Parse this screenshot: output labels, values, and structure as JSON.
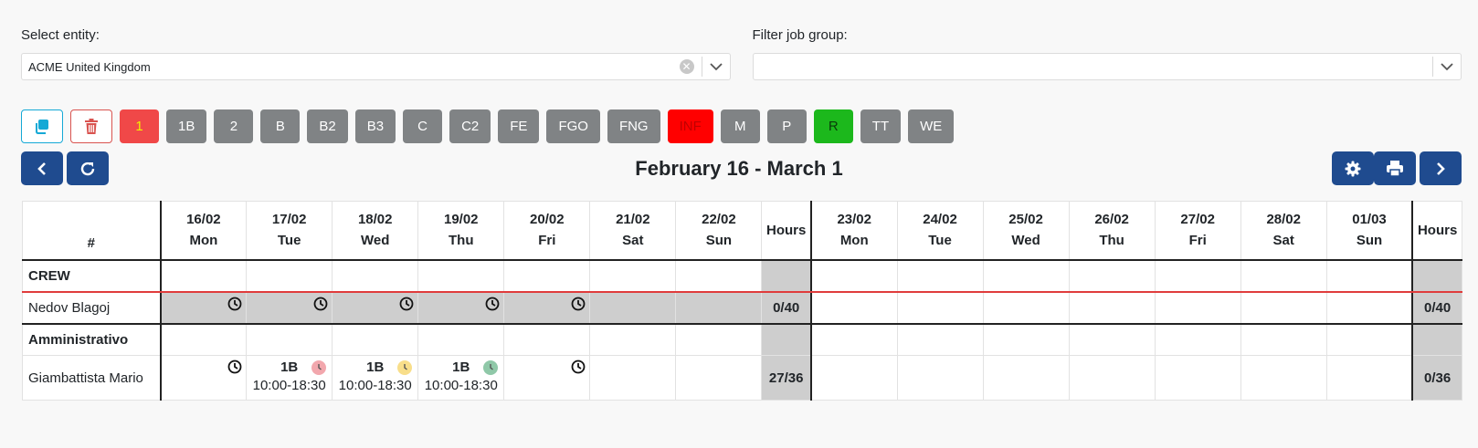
{
  "filters": {
    "entity_label": "Select entity:",
    "entity_value": "ACME United Kingdom",
    "job_group_label": "Filter job group:",
    "job_group_value": ""
  },
  "toolbar": {
    "tags": [
      {
        "label": "1",
        "bg": "#f04848",
        "fg": "#f0f000"
      },
      {
        "label": "1B",
        "bg": "#808385",
        "fg": "#ffffff"
      },
      {
        "label": "2",
        "bg": "#808385",
        "fg": "#ffffff"
      },
      {
        "label": "B",
        "bg": "#808385",
        "fg": "#ffffff"
      },
      {
        "label": "B2",
        "bg": "#808385",
        "fg": "#ffffff"
      },
      {
        "label": "B3",
        "bg": "#808385",
        "fg": "#ffffff"
      },
      {
        "label": "C",
        "bg": "#808385",
        "fg": "#ffffff"
      },
      {
        "label": "C2",
        "bg": "#808385",
        "fg": "#ffffff"
      },
      {
        "label": "FE",
        "bg": "#808385",
        "fg": "#ffffff"
      },
      {
        "label": "FGO",
        "bg": "#808385",
        "fg": "#ffffff"
      },
      {
        "label": "FNG",
        "bg": "#808385",
        "fg": "#ffffff"
      },
      {
        "label": "INF",
        "bg": "#ff0000",
        "fg": "#c00000"
      },
      {
        "label": "M",
        "bg": "#808385",
        "fg": "#ffffff"
      },
      {
        "label": "P",
        "bg": "#808385",
        "fg": "#ffffff"
      },
      {
        "label": "R",
        "bg": "#1cb81c",
        "fg": "#0a3a0a"
      },
      {
        "label": "TT",
        "bg": "#808385",
        "fg": "#ffffff"
      },
      {
        "label": "WE",
        "bg": "#808385",
        "fg": "#ffffff"
      }
    ]
  },
  "period": {
    "title": "February 16 - March 1"
  },
  "table": {
    "hash_header": "#",
    "hours_header": "Hours",
    "week1": [
      {
        "date": "16/02",
        "day": "Mon"
      },
      {
        "date": "17/02",
        "day": "Tue"
      },
      {
        "date": "18/02",
        "day": "Wed"
      },
      {
        "date": "19/02",
        "day": "Thu"
      },
      {
        "date": "20/02",
        "day": "Fri"
      },
      {
        "date": "21/02",
        "day": "Sat"
      },
      {
        "date": "22/02",
        "day": "Sun"
      }
    ],
    "week2": [
      {
        "date": "23/02",
        "day": "Mon"
      },
      {
        "date": "24/02",
        "day": "Tue"
      },
      {
        "date": "25/02",
        "day": "Wed"
      },
      {
        "date": "26/02",
        "day": "Thu"
      },
      {
        "date": "27/02",
        "day": "Fri"
      },
      {
        "date": "28/02",
        "day": "Sat"
      },
      {
        "date": "01/03",
        "day": "Sun"
      }
    ],
    "groups": [
      {
        "name": "CREW",
        "people": [
          {
            "name": "Nedov Blagoj",
            "hours1": "0/40",
            "hours2": "0/40"
          }
        ]
      },
      {
        "name": "Amministrativo",
        "people": [
          {
            "name": "Giambattista Mario",
            "hours1": "27/36",
            "hours2": "0/36",
            "shifts": [
              {
                "code": "1B",
                "time": "10:00-18:30",
                "dot": "#f2a7ad"
              },
              {
                "code": "1B",
                "time": "10:00-18:30",
                "dot": "#f8de8a"
              },
              {
                "code": "1B",
                "time": "10:00-18:30",
                "dot": "#8fc8a8"
              }
            ]
          }
        ]
      }
    ]
  },
  "colors": {
    "primary": "#1f4b8f",
    "info": "#15a9d6",
    "danger": "#d9534f"
  }
}
